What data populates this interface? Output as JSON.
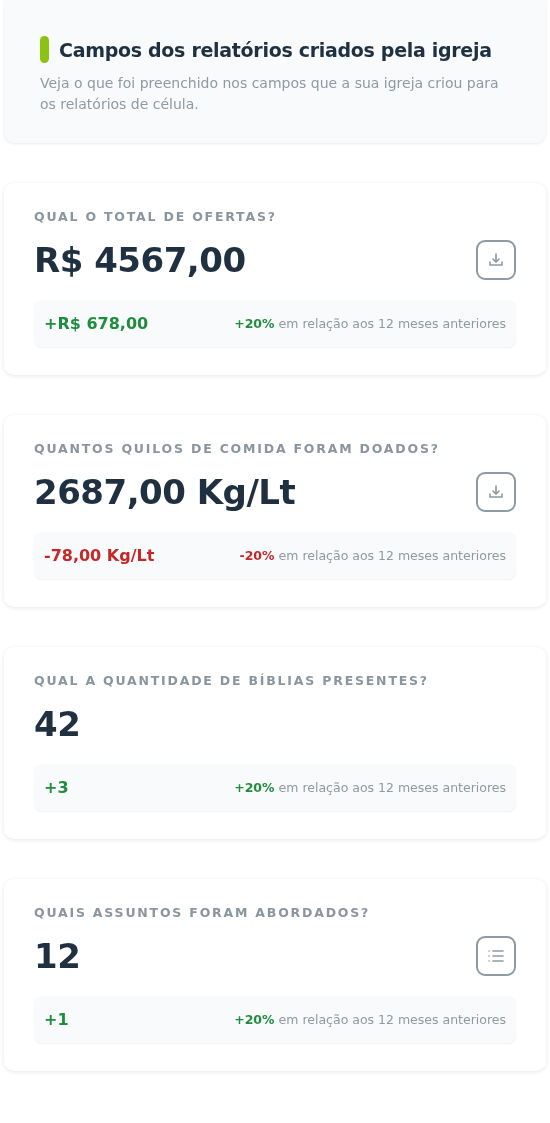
{
  "header": {
    "title": "Campos dos relatórios criados pela igreja",
    "description": "Veja o que foi preenchido nos campos que a sua igreja criou para os relatórios de célula."
  },
  "cards": [
    {
      "question": "QUAL O TOTAL DE OFERTAS?",
      "value": "R$ 4567,00",
      "kind": "download",
      "change": "+R$ 678,00",
      "color": "#1e8e3e",
      "percent": "+20%",
      "comparison": "em relação aos 12 meses anteriores"
    },
    {
      "question": "QUANTOS QUILOS DE COMIDA FORAM DOADOS?",
      "value": "2687,00 Kg/Lt",
      "kind": "download",
      "change": "-78,00 Kg/Lt",
      "color": "#c62828",
      "percent": "-20%",
      "comparison": "em relação aos 12 meses anteriores"
    },
    {
      "question": "QUAL A QUANTIDADE DE BÍBLIAS PRESENTES?",
      "value": "42",
      "kind": "plain",
      "change": "+3",
      "color": "#1e8e3e",
      "percent": "+20%",
      "comparison": "em relação aos 12 meses anteriores"
    },
    {
      "question": "QUAIS ASSUNTOS FORAM ABORDADOS?",
      "value": "12",
      "kind": "list",
      "change": "+1",
      "color": "#1e8e3e",
      "percent": "+20%",
      "comparison": "em relação aos 12 meses anteriores"
    }
  ]
}
